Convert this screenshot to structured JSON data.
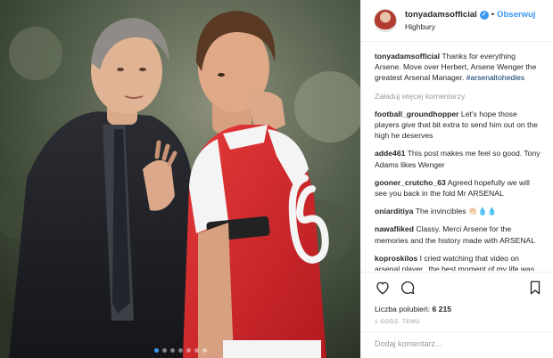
{
  "header": {
    "username": "tonyadamsofficial",
    "verified_glyph": "✓",
    "separator": "•",
    "follow_label": "Obserwuj",
    "location": "Highbury"
  },
  "caption": {
    "username": "tonyadamsofficial",
    "text": "Thanks for everything Arsene. Move over Herbert, Arsene Wenger the greatest Arsenal Manager.",
    "hashtag": "#arsenaltohedies"
  },
  "load_more_label": "Załaduj więcej komentarzy",
  "comments": [
    {
      "username": "football_groundhopper",
      "text": "Let's hope those players give that bit extra to send him out on the high he deserves"
    },
    {
      "username": "adde461",
      "text": "This post makes me feel so good. Tony Adams likes Wenger"
    },
    {
      "username": "gooner_crutcho_63",
      "text": "Agreed hopefully we will see you back in the fold Mr ARSENAL"
    },
    {
      "username": "oniarditiya",
      "text": "The invincibles 👏🏻💧💧"
    },
    {
      "username": "nawafliked",
      "text": "Classy. Merci Arsene for the memories and the history made with ARSENAL"
    },
    {
      "username": "koproskilos",
      "text": "I cried watching that video on arsenal player.. the best moment of my life was watching you and him lift the two"
    }
  ],
  "likes": {
    "label": "Liczba polubień:",
    "count": "6 215"
  },
  "time_ago": "1 GODZ. TEMU",
  "add_comment_placeholder": "Dodaj komentarz...",
  "carousel": {
    "total": 7,
    "active": 0
  },
  "colors": {
    "link": "#3897f0",
    "hashtag": "#003569",
    "muted": "#999999",
    "arsenal_red": "#d9262c"
  },
  "icons": [
    "heart-icon",
    "comment-icon",
    "bookmark-icon",
    "verified-badge-icon"
  ]
}
